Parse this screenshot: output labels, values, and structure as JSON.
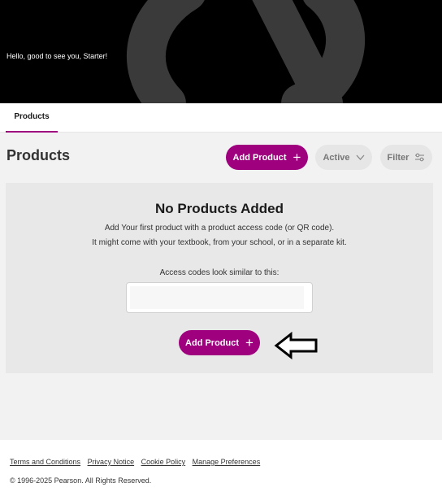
{
  "hero": {
    "greeting": "Hello, good to see you, Starter!"
  },
  "tabs": [
    {
      "label": "Products",
      "selected": true
    }
  ],
  "main": {
    "title": "Products",
    "add_product_label": "Add Product",
    "active_label": "Active",
    "filter_label": "Filter"
  },
  "empty_state": {
    "title": "No Products Added",
    "line1": "Add Your first product with a product access code (or QR code).",
    "line2": "It might come with your textbook, from your school, or in a separate kit.",
    "code_label": "Access codes look similar to this:",
    "add_product_label": "Add Product"
  },
  "footer": {
    "links": [
      "Terms and Conditions",
      "Privacy Notice",
      "Cookie Policy",
      "Manage Preferences"
    ],
    "copyright": "© 1996-2025 Pearson. All Rights Reserved."
  },
  "colors": {
    "brand": "#9e007e",
    "hero_bg": "#000000",
    "page_bg": "#f2f2f2"
  }
}
